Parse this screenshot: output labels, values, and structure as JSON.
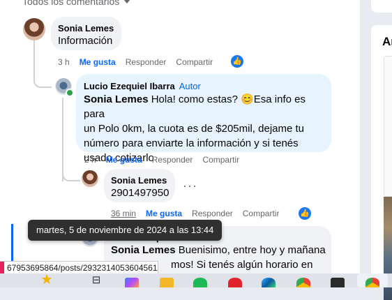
{
  "header": {
    "filter_label": "Todos los comentarios"
  },
  "sidebar": {
    "section_title": "Ar"
  },
  "comments": [
    {
      "author": "Sonia Lemes",
      "text": "Información",
      "time": "3 h",
      "actions": {
        "like": "Me gusta",
        "reply": "Responder",
        "share": "Compartir"
      }
    },
    {
      "author": "Lucio Ezequiel Ibarra",
      "badge": "Autor",
      "mention": "Sonia Lemes",
      "text_line1": "Hola! como estas? 😊Esa info es para",
      "text_line2": "un Polo 0km, la cuota es de $205mil, dejame tu",
      "text_line3": "número para enviarte la información y si tenés",
      "text_line4": "usado cotizarlo",
      "time": "2 h",
      "actions": {
        "like": "Me gusta",
        "reply": "Responder",
        "share": "Compartir"
      }
    },
    {
      "author": "Sonia Lemes",
      "text": "2901497950",
      "time": "36 min",
      "more": "···",
      "actions": {
        "like": "Me gusta",
        "reply": "Responder",
        "share": "Compartir"
      }
    },
    {
      "author": "Lucio Ezequiel Ibarra",
      "mention": "Sonia Lemes",
      "text_line1": "Buenisimo, entre hoy y mañana",
      "text_line2": "mos! Si tenés algún horario en"
    }
  ],
  "tooltip": {
    "text": "martes, 5 de noviembre de 2024 a las 13:44"
  },
  "status_bar": {
    "url": "67953695864/posts/2932314053604561/..."
  },
  "taskbar": {
    "icons": [
      "star-icon",
      "task-view-icon",
      "copilot-icon",
      "folder-icon",
      "spotify-icon",
      "opera-icon",
      "edge-icon",
      "chrome-icon",
      "app-icon",
      "chrome-icon"
    ]
  },
  "colors": {
    "link_blue": "#0866ff",
    "author_badge": "#0064d1",
    "bubble": "#f0f2f5",
    "author_bubble": "#e7f3ff",
    "online": "#31a24c"
  }
}
